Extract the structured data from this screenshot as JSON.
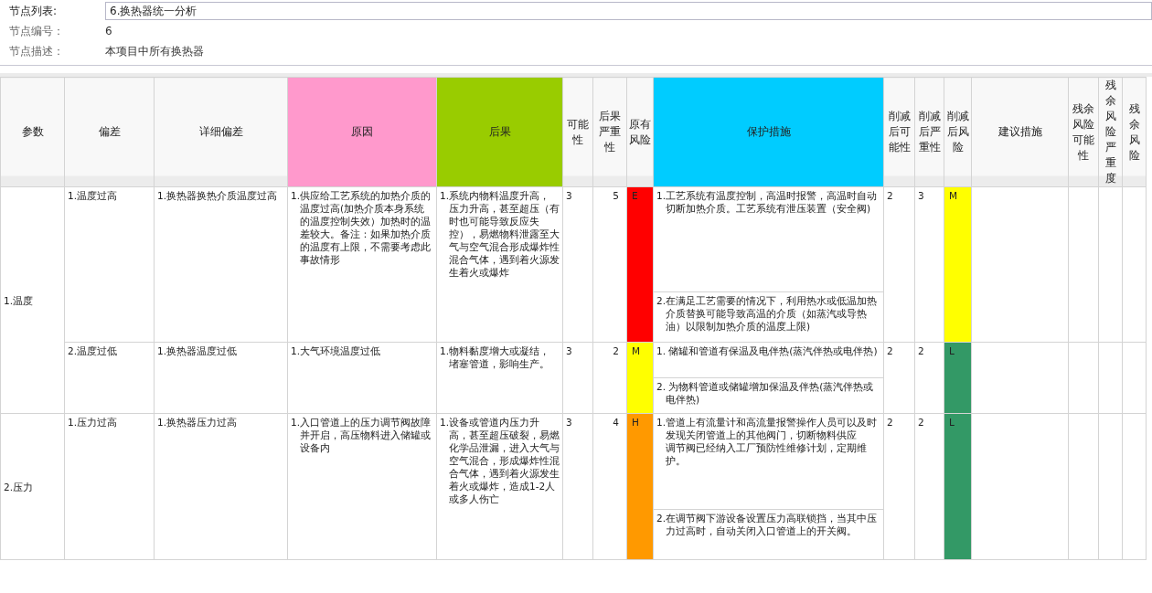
{
  "node": {
    "list_label": "节点列表:",
    "list_value": "6.换热器统一分析",
    "number_label": "节点编号：",
    "number_value": "6",
    "desc_label": "节点描述：",
    "desc_value": "本项目中所有换热器"
  },
  "columns": [
    {
      "label": "参数"
    },
    {
      "label": "偏差"
    },
    {
      "label": "详细偏差"
    },
    {
      "label": "原因",
      "color": "#ff99cc"
    },
    {
      "label": "后果",
      "color": "#99cc00"
    },
    {
      "label": "可能性"
    },
    {
      "label": "后果严重性"
    },
    {
      "label": "原有风险"
    },
    {
      "label": "保护措施",
      "color": "#00ccff"
    },
    {
      "label": "削减后可能性"
    },
    {
      "label": "削减后严重性"
    },
    {
      "label": "削减后风险"
    },
    {
      "label": "建议措施"
    },
    {
      "label": "残余风险可能性"
    },
    {
      "label": "残余风险严重度"
    },
    {
      "label": "残余风险"
    }
  ],
  "params": [
    {
      "name": "1.温度",
      "deviations": [
        {
          "deviation": "1.温度过高",
          "detail": "1.换热器换热介质温度过高",
          "cause": "1.供应给工艺系统的加热介质的温度过高(加热介质本身系统的温度控制失效）加热时的温差较大。备注：如果加热介质的温度有上限，不需要考虑此事故情形",
          "consequence": "1.系统内物料温度升高，压力升高，甚至超压（有时也可能导致反应失控），易燃物料泄露至大气与空气混合形成爆炸性混合气体，遇到着火源发生着火或爆炸",
          "likelihood": "3",
          "severity": "5",
          "risk": {
            "label": "E",
            "color": "#ff0000"
          },
          "protections": [
            [
              "1.工艺系统有温度控制，高温时报警，高温时自动切断加热介质。工艺系统有泄压装置（安全阀)"
            ],
            [
              "2.在满足工艺需要的情况下，利用热水或低温加热介质替换可能导致高温的介质（如蒸汽或导热油）以限制加热介质的温度上限)"
            ]
          ],
          "reduced_likelihood": "2",
          "reduced_severity": "3",
          "reduced_risk": {
            "label": "M",
            "color": "#ffff00"
          }
        },
        {
          "deviation": "2.温度过低",
          "detail": "1.换热器温度过低",
          "cause": "1.大气环境温度过低",
          "consequence": "1.物料黏度增大或凝结，堵塞管道，影响生产。",
          "likelihood": "3",
          "severity": "2",
          "risk": {
            "label": "M",
            "color": "#ffff00"
          },
          "protections": [
            [
              "1. 储罐和管道有保温及电伴热(蒸汽伴热或电伴热)"
            ],
            [
              "2. 为物料管道或储罐增加保温及伴热(蒸汽伴热或电伴热)"
            ]
          ],
          "reduced_likelihood": "2",
          "reduced_severity": "2",
          "reduced_risk": {
            "label": "L",
            "color": "#339966"
          }
        }
      ]
    },
    {
      "name": "2.压力",
      "deviations": [
        {
          "deviation": "1.压力过高",
          "detail": "1.换热器压力过高",
          "cause": "1.入口管道上的压力调节阀故障并开启，高压物料进入储罐或设备内",
          "consequence": "1.设备或管道内压力升高，甚至超压破裂，易燃化学品泄漏，进入大气与空气混合，形成爆炸性混合气体，遇到着火源发生着火或爆炸，造成1-2人或多人伤亡",
          "likelihood": "3",
          "severity": "4",
          "risk": {
            "label": "H",
            "color": "#ff9900"
          },
          "protections": [
            [
              "1.管道上有流量计和高流量报警操作人员可以及时发现关闭管道上的其他阀门，切断物料供应",
              "调节阀已经纳入工厂预防性维修计划，定期维护。"
            ],
            [
              "2.在调节阀下游设备设置压力高联锁挡，当其中压力过高时，自动关闭入口管道上的开关阀。"
            ]
          ],
          "reduced_likelihood": "2",
          "reduced_severity": "2",
          "reduced_risk": {
            "label": "L",
            "color": "#339966"
          }
        }
      ]
    }
  ]
}
